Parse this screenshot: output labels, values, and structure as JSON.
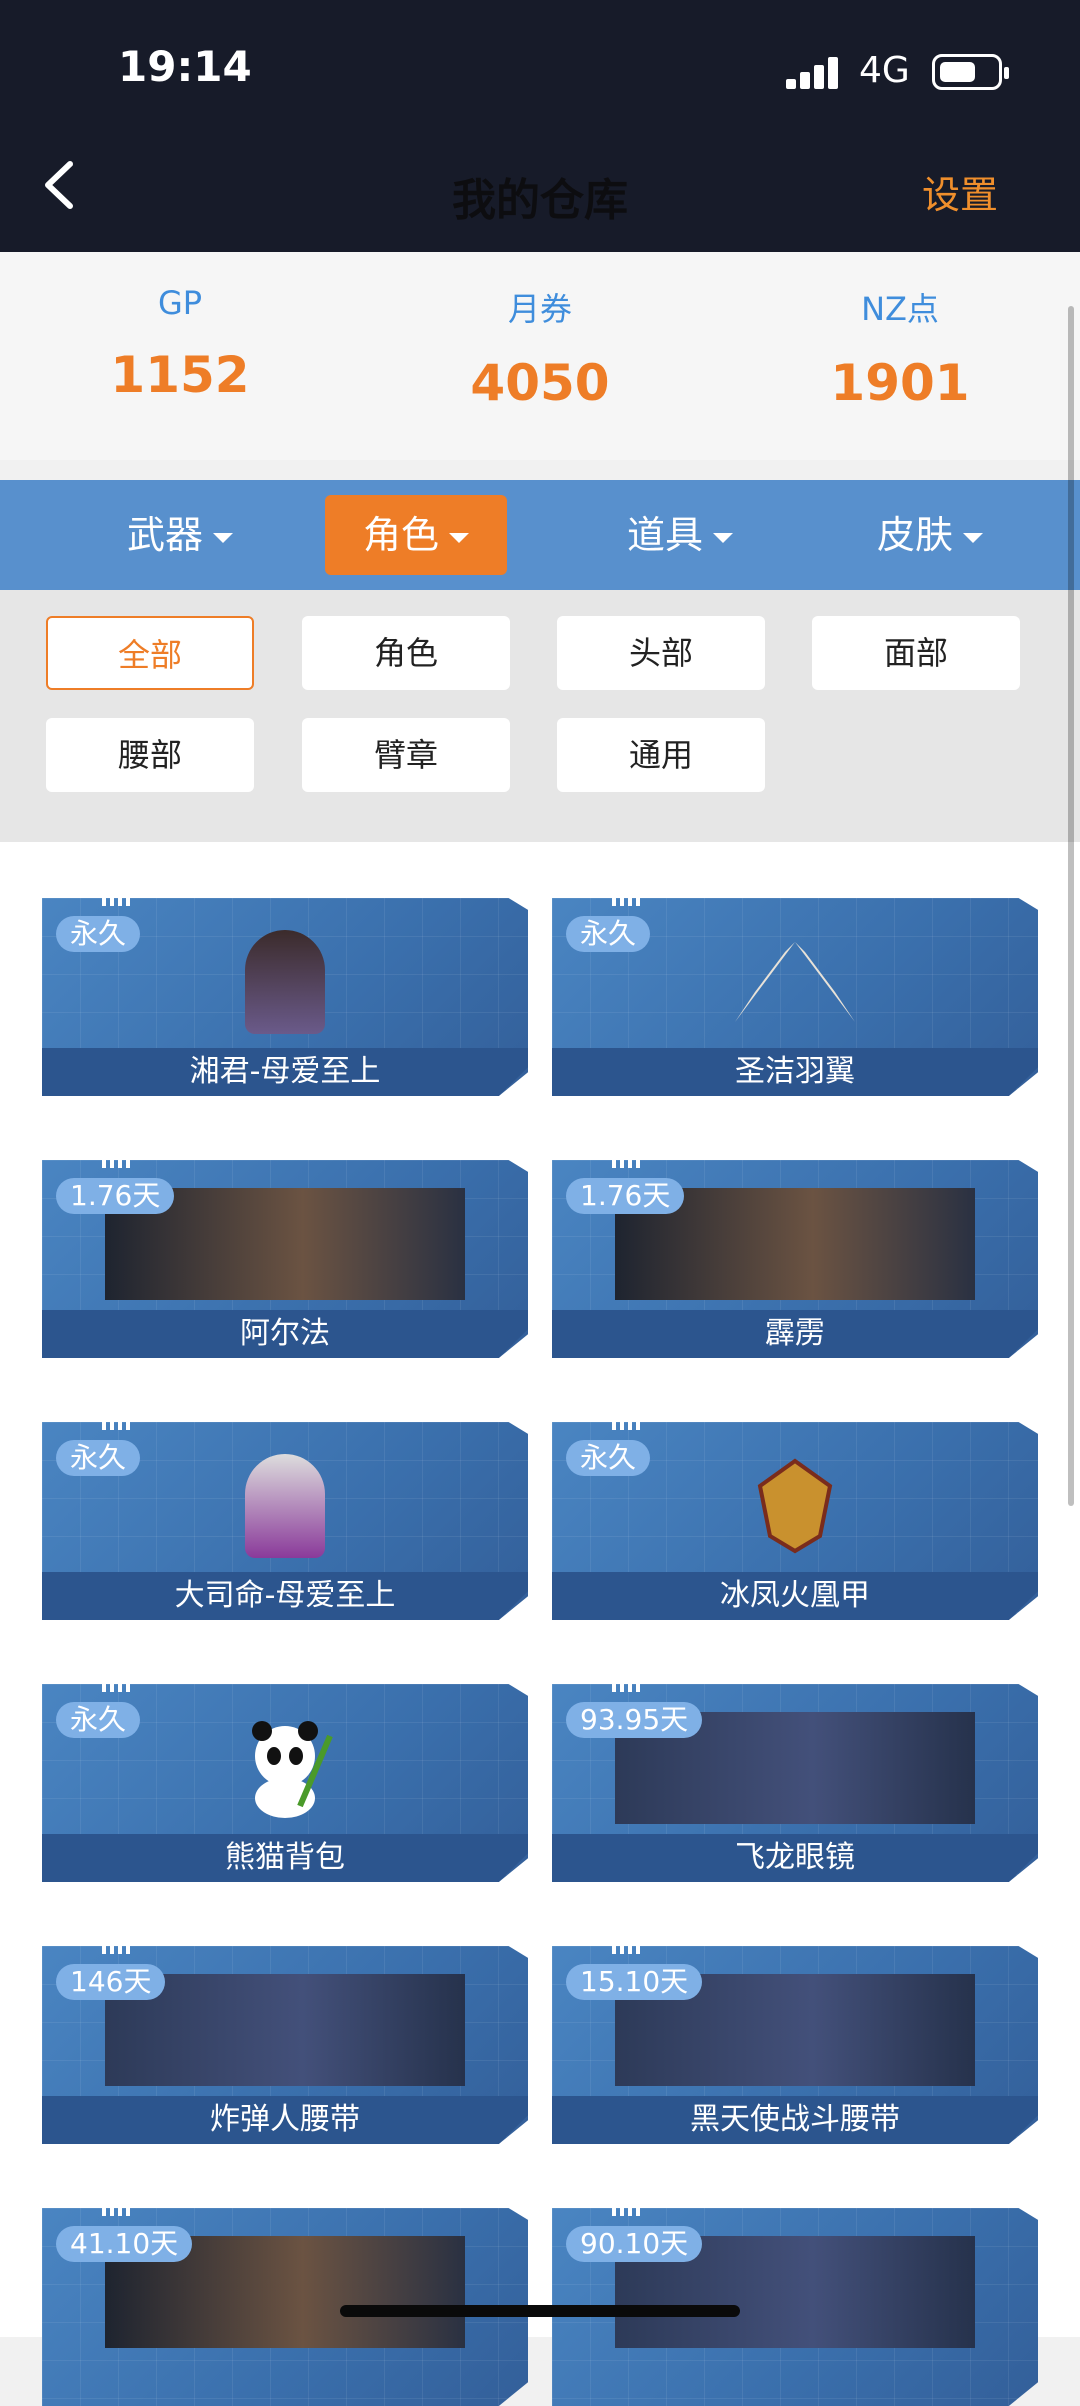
{
  "status_bar": {
    "time": "19:14",
    "network": "4G"
  },
  "nav": {
    "title": "我的仓库",
    "settings": "设置"
  },
  "currency": [
    {
      "label": "GP",
      "value": "1152"
    },
    {
      "label": "月券",
      "value": "4050"
    },
    {
      "label": "NZ点",
      "value": "1901"
    }
  ],
  "tabs": [
    "武器",
    "角色",
    "道具",
    "皮肤"
  ],
  "active_tab": "角色",
  "filters": [
    "全部",
    "角色",
    "头部",
    "面部",
    "腰部",
    "臂章",
    "通用"
  ],
  "active_filter": "全部",
  "items": [
    {
      "badge": "永久",
      "name": "湘君-母爱至上",
      "icon": "character-figure"
    },
    {
      "badge": "永久",
      "name": "圣洁羽翼",
      "icon": "wings-icon"
    },
    {
      "badge": "1.76天",
      "name": "阿尔法",
      "icon": "character-portrait"
    },
    {
      "badge": "1.76天",
      "name": "霹雳",
      "icon": "character-portrait"
    },
    {
      "badge": "永久",
      "name": "大司命-母爱至上",
      "icon": "character-figure"
    },
    {
      "badge": "永久",
      "name": "冰凤火凰甲",
      "icon": "armor-icon"
    },
    {
      "badge": "永久",
      "name": "熊猫背包",
      "icon": "panda-backpack-icon"
    },
    {
      "badge": "93.95天",
      "name": "飞龙眼镜",
      "icon": "goggles-portrait"
    },
    {
      "badge": "146天",
      "name": "炸弹人腰带",
      "icon": "belt-portrait"
    },
    {
      "badge": "15.10天",
      "name": "黑天使战斗腰带",
      "icon": "belt-portrait"
    },
    {
      "badge": "41.10天",
      "name": "",
      "icon": "character-portrait"
    },
    {
      "badge": "90.10天",
      "name": "",
      "icon": "helmet-portrait"
    }
  ],
  "colors": {
    "accent": "#ee7d27",
    "tab_bar": "#5890cd",
    "header": "#171b29",
    "card": "#3a6fac"
  }
}
